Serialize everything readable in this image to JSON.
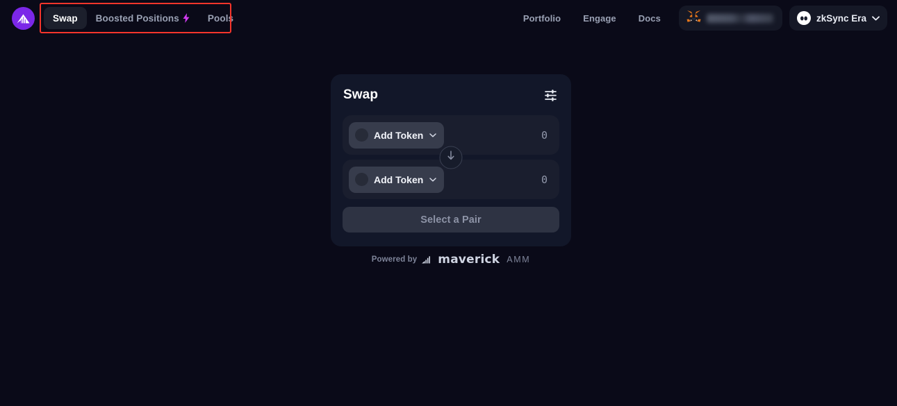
{
  "theme": {
    "page_bg": "#0a0a18",
    "card_bg": "#121729",
    "row_bg": "#1a1e2e",
    "pill_bg": "#373c4c",
    "brand_purple": "#7b27e8",
    "bolt_magenta": "#d13bf0",
    "annotation_red": "#f5352b",
    "muted_text": "#9aa1b4"
  },
  "header": {
    "logo_icon": "maverick-logo-icon",
    "tabs": [
      {
        "label": "Swap",
        "active": true,
        "icon": null
      },
      {
        "label": "Boosted Positions",
        "active": false,
        "icon": "lightning-bolt-icon"
      },
      {
        "label": "Pools",
        "active": false,
        "icon": null
      }
    ],
    "links": [
      {
        "label": "Portfolio"
      },
      {
        "label": "Engage"
      },
      {
        "label": "Docs"
      }
    ],
    "wallet": {
      "icon": "metamask-fox-icon",
      "address": ""
    },
    "network": {
      "icon": "zksync-logo-icon",
      "label": "zkSync Era",
      "chevron": "chevron-down-icon"
    }
  },
  "swap_card": {
    "title": "Swap",
    "settings_icon": "sliders-settings-icon",
    "from": {
      "token_label": "Add Token",
      "token_icon": "token-placeholder-icon",
      "chevron": "chevron-down-icon",
      "amount": "0",
      "amount_placeholder": "0"
    },
    "to": {
      "token_label": "Add Token",
      "token_icon": "token-placeholder-icon",
      "chevron": "chevron-down-icon",
      "amount": "0",
      "amount_placeholder": "0"
    },
    "swap_direction_icon": "arrow-down-icon",
    "cta_label": "Select a Pair"
  },
  "footer": {
    "powered_by": "Powered by",
    "brand_mark_icon": "maverick-bars-icon",
    "brand_name": "maverick",
    "product": "AMM"
  }
}
